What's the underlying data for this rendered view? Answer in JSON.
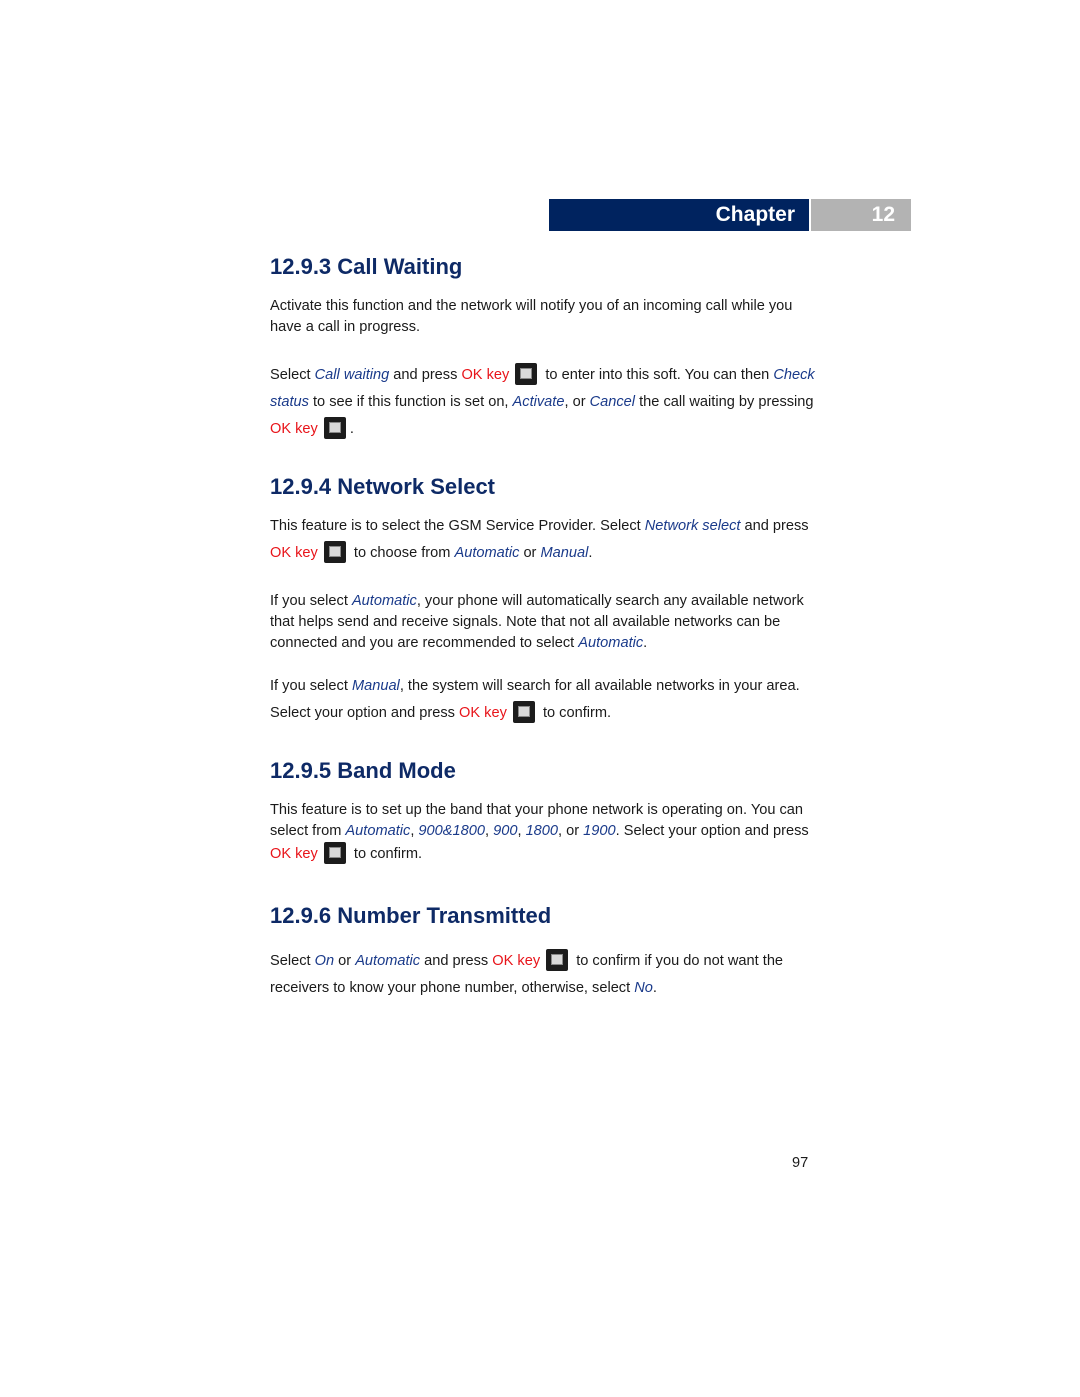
{
  "header": {
    "chapter_label": "Chapter",
    "chapter_number": "12"
  },
  "sections": [
    {
      "title": "12.9.3 Call Waiting",
      "p1": "Activate this function and the network will notify you of an incoming call while you have a call in progress.",
      "p2": {
        "t1": "Select ",
        "term1": "Call waiting",
        "t2": " and press ",
        "ok1": "OK key",
        "t3": " to enter into this soft. You can then ",
        "term2": "Check status",
        "t4": " to see if this function is set on, ",
        "term3": "Activate",
        "t5": ", or ",
        "term4": "Cancel",
        "t6": " the call waiting by pressing ",
        "ok2": "OK key",
        "t7": "."
      }
    },
    {
      "title": "12.9.4 Network Select",
      "p1": {
        "t1": "This feature is to select the GSM Service Provider. Select ",
        "term1": "Network select",
        "t2": " and press ",
        "ok1": "OK key",
        "t3": " to choose from ",
        "term2": "Automatic",
        "t4": " or ",
        "term3": "Manual",
        "t5": "."
      },
      "p2": {
        "t1": "If you select ",
        "term1": "Automatic",
        "t2": ", your phone will automatically search any available network that helps send and receive signals. Note that not all available networks can be connected and you are recommended to select ",
        "term2": "Automatic",
        "t3": "."
      },
      "p3": {
        "t1": "If you select ",
        "term1": "Manual",
        "t2": ", the system will search for all available networks in your area. Select your option and press ",
        "ok1": "OK key",
        "t3": " to confirm."
      }
    },
    {
      "title": "12.9.5 Band Mode",
      "p1": {
        "t1": "This feature is to set up the band that your phone network is operating on. You can select from ",
        "term1": "Automatic",
        "t2": ", ",
        "term2": "900&1800",
        "t3": ", ",
        "term3": "900",
        "t4": ", ",
        "term4": "1800",
        "t5": ", or ",
        "term5": "1900",
        "t6": ". Select your option and press ",
        "ok1": "OK key",
        "t7": " to confirm."
      }
    },
    {
      "title": "12.9.6 Number Transmitted",
      "p1": {
        "t1": "Select ",
        "term1": "On",
        "t2": " or ",
        "term2": "Automatic",
        "t3": " and press ",
        "ok1": "OK key",
        "t4": " to confirm if you do not want the receivers to know your phone number, otherwise, select ",
        "term3": "No",
        "t5": "."
      }
    }
  ],
  "footer": {
    "page_number": "97"
  },
  "colors": {
    "heading": "#0e2a66",
    "term": "#1a3a8a",
    "ok_key": "#e8141a",
    "chapter_bar": "#00235f",
    "chapter_num_bg": "#b3b3b3"
  }
}
